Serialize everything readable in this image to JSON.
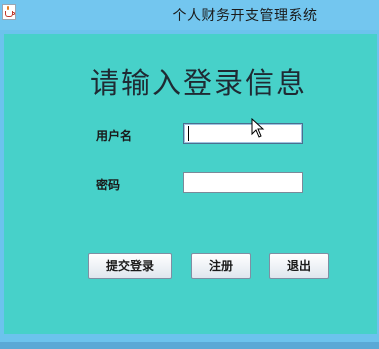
{
  "window": {
    "title": "个人财务开支管理系统",
    "icon": "java-cup-icon"
  },
  "login": {
    "heading": "请输入登录信息",
    "username_label": "用户名",
    "username_value": "",
    "password_label": "密码",
    "password_value": ""
  },
  "buttons": {
    "submit_label": "提交登录",
    "register_label": "注册",
    "exit_label": "退出"
  },
  "colors": {
    "titlebar": "#73c6ef",
    "content_bg": "#47d1c9",
    "button_bg": "#eef2f6"
  }
}
